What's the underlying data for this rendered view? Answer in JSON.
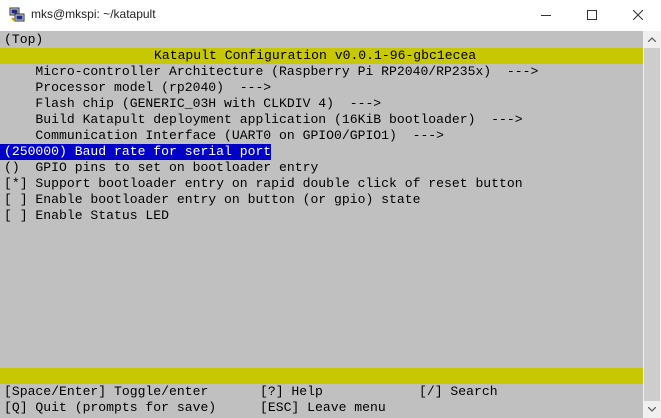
{
  "window": {
    "title": "mks@mkspi: ~/katapult",
    "icons": {
      "app": "putty-icon",
      "minimize": "minimize-icon",
      "maximize": "maximize-icon",
      "close": "close-icon"
    }
  },
  "menu": {
    "breadcrumb": "(Top)",
    "header": "Katapult Configuration v0.0.1-96-gbc1ecea",
    "items": [
      "    Micro-controller Architecture (Raspberry Pi RP2040/RP235x)  --->",
      "    Processor model (rp2040)  --->",
      "    Flash chip (GENERIC_03H with CLKDIV 4)  --->",
      "    Build Katapult deployment application (16KiB bootloader)  --->",
      "    Communication Interface (UART0 on GPIO0/GPIO1)  --->",
      "(250000) Baud rate for serial port",
      "()  GPIO pins to set on bootloader entry",
      "[*] Support bootloader entry on rapid double click of reset button",
      "[ ] Enable bootloader entry on button (or gpio) state",
      "[ ] Enable Status LED"
    ],
    "selected_index": 5
  },
  "hints": {
    "row1": [
      "[Space/Enter] Toggle/enter",
      "[?] Help",
      "[/] Search"
    ],
    "row2": [
      "[Q] Quit (prompts for save)",
      "[ESC] Leave menu"
    ]
  },
  "colors": {
    "terminal_bg": "#c0c0c0",
    "yellow_bar": "#c8c800",
    "selection_bg": "#0000c8",
    "selection_fg": "#ffffff"
  }
}
